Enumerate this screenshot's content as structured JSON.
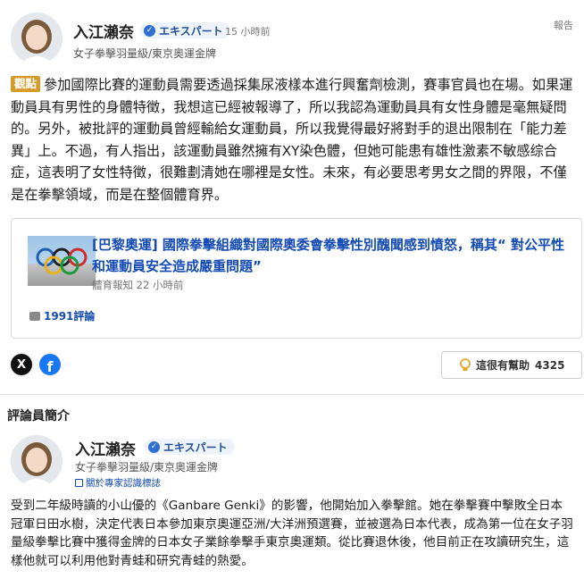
{
  "author": {
    "name": "入江瀨奈",
    "badge": "エキスパート",
    "time": "15 小時前",
    "role": "女子拳擊羽量級/東京奧運金牌",
    "report": "報告"
  },
  "comment": {
    "tag": "觀點",
    "text": "參加國際比賽的運動員需要透過採集尿液樣本進行興奮劑檢測，賽事官員也在場。如果運動員具有男性的身體特徵，我想這已經被報導了，所以我認為運動員具有女性身體是毫無疑問的。另外，被批評的運動員曾經輸給女運動員，所以我覺得最好將對手的退出限制在「能力差異」上。不過，有人指出，該運動員雖然擁有XY染色體，但她可能患有雄性激素不敏感综合症，這表明了女性特徵，很難劃清她在哪裡是女性。未來，有必要思考男女之間的界限，不僅是在拳擊領域，而是在整個體育界。"
  },
  "article": {
    "title": "[巴黎奧運] 國際拳擊組織對國際奧委會拳擊性別醜聞感到憤怒，稱其“ 對公平性和運動員安全造成嚴重問題”",
    "source": "體育報知",
    "time": "22 小時前",
    "comments": "1991評論"
  },
  "share": {
    "x_label": "X",
    "fb_label": "f"
  },
  "helpful": {
    "label": "這很有幫助",
    "count": "4325"
  },
  "profile": {
    "section_title": "評論員簡介",
    "name": "入江瀨奈",
    "badge": "エキスパート",
    "role": "女子拳擊羽量級/東京奧運金牌",
    "link": "關於專家認識標誌",
    "bio": "受到二年級時讀的小山優的《Ganbare Genki》的影響，他開始加入拳擊館。她在拳擊賽中擊敗全日本冠軍日田水樹，決定代表日本參加東京奧運亞洲/大洋洲預選賽，並被選為日本代表，成為第一位在女子羽量級拳擊比賽中獲得金牌的日本女子業餘拳擊手東京奧運類。從比賽退休後，他目前正在攻讀研究生，這樣他就可以利用他對青蛙和研究青蛙的熱愛。"
  },
  "colors": {
    "tag_bg": "#d59b2b",
    "link": "#134bb3",
    "badge_check": "#2f6fd1",
    "facebook": "#1877f2"
  }
}
